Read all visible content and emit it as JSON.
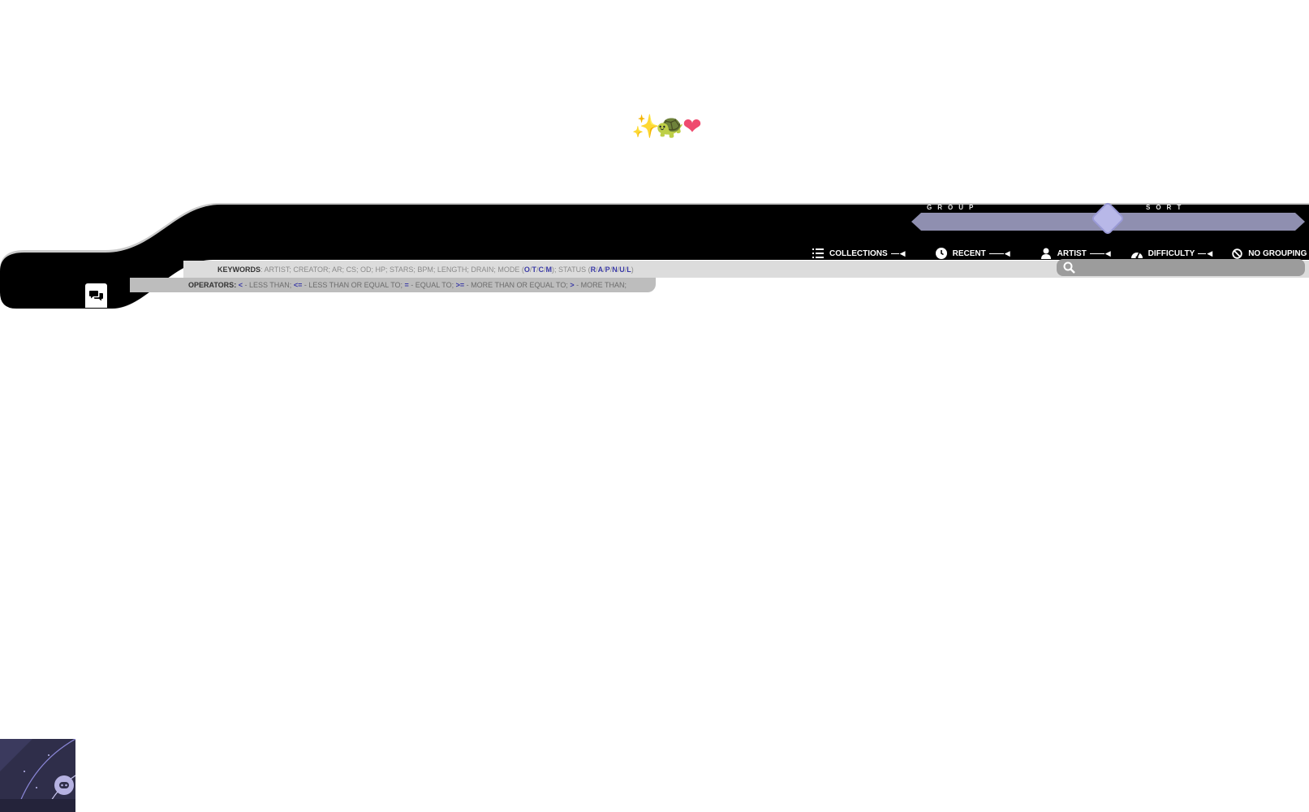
{
  "emojis": [
    "✨",
    "🐢",
    "❤"
  ],
  "group_label": "GROUP",
  "sort_label": "SORT",
  "tabs": [
    {
      "label": "COLLECTIONS",
      "icon": "list-icon"
    },
    {
      "label": "RECENT",
      "icon": "clock-icon"
    },
    {
      "label": "ARTIST",
      "icon": "person-icon"
    },
    {
      "label": "DIFFICULTY",
      "icon": "gauge-icon"
    },
    {
      "label": "NO GROUPING",
      "icon": "ban-icon"
    }
  ],
  "keywords": {
    "label": "KEYWORDS",
    "prefix": ": ARTIST; CREATOR; AR; CS; OD; HP; STARS; BPM; LENGTH; DRAIN; MODE (",
    "mode_flags": [
      "O",
      "T",
      "C",
      "M"
    ],
    "mid": "); STATUS (",
    "status_flags": [
      "R",
      "A",
      "P",
      "N",
      "U",
      "L"
    ],
    "suffix": ")"
  },
  "operators": {
    "label": "OPERATORS",
    "items": [
      {
        "symbol": "<",
        "desc": " - LESS THAN; "
      },
      {
        "symbol": "<=",
        "desc": " - LESS THAN OR EQUAL TO; "
      },
      {
        "symbol": "=",
        "desc": " - EQUAL TO; "
      },
      {
        "symbol": ">=",
        "desc": " - MORE THAN OR EQUAL TO; "
      },
      {
        "symbol": ">",
        "desc": " - MORE THAN;"
      }
    ]
  },
  "search": {
    "value": "",
    "placeholder": ""
  },
  "colors": {
    "header_bg": "#000000",
    "accent": "#8f8fb0",
    "knob": "#b8b8e8",
    "highlight": "#3a3aa6"
  }
}
